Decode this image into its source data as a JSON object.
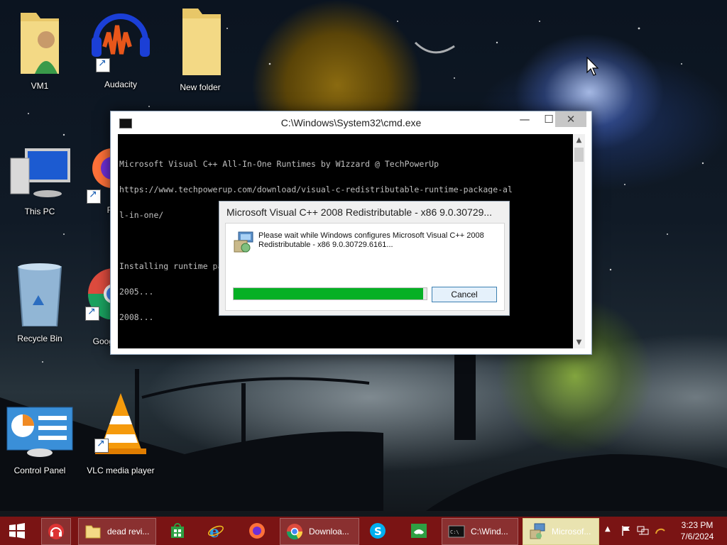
{
  "desktop": {
    "icons": [
      {
        "label": "VM1"
      },
      {
        "label": "Audacity"
      },
      {
        "label": "New folder"
      },
      {
        "label": "This PC"
      },
      {
        "label": "F"
      },
      {
        "label": "Recycle Bin"
      },
      {
        "label": "Goog"
      },
      {
        "label": "Control Panel"
      },
      {
        "label": "VLC media player"
      }
    ]
  },
  "cmd": {
    "title": "C:\\Windows\\System32\\cmd.exe",
    "minimize": "—",
    "maximize": "☐",
    "close": "✕",
    "lines": [
      "Microsoft Visual C++ All-In-One Runtimes by W1zzard @ TechPowerUp",
      "https://www.techpowerup.com/download/visual-c-redistributable-runtime-package-al",
      "l-in-one/",
      "",
      "Installing runtime packages...",
      "2005...",
      "2008..."
    ]
  },
  "installer": {
    "title": "Microsoft Visual C++ 2008 Redistributable - x86 9.0.30729...",
    "message": "Please wait while Windows configures Microsoft Visual C++ 2008 Redistributable - x86 9.0.30729.6161...",
    "progress": 0.98,
    "cancel_label": "Cancel"
  },
  "taskbar": {
    "items": [
      {
        "label": "dead revi..."
      },
      {
        "label": "Downloa..."
      },
      {
        "label": "C:\\Wind..."
      },
      {
        "label": "Microsof..."
      }
    ],
    "clock_time": "3:23 PM",
    "clock_date": "7/6/2024"
  },
  "colors": {
    "taskbar": "#7a1414",
    "progress_fill": "#06b025",
    "active_task": "#e9e3b0"
  }
}
